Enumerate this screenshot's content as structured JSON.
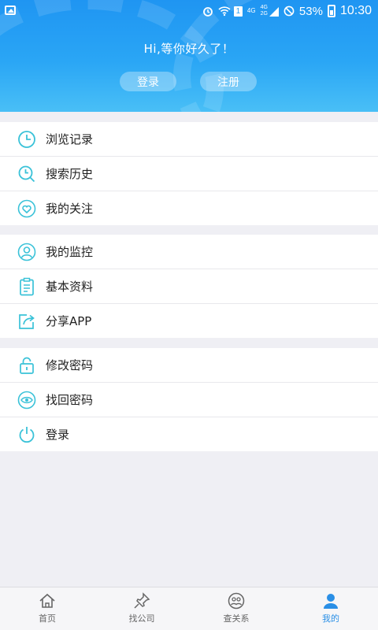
{
  "status_bar": {
    "network": "4G",
    "network2": "4G",
    "network3": "2G",
    "sim": "1",
    "battery_percent": "53%",
    "time": "10:30"
  },
  "header": {
    "greeting": "Hi,等你好久了！",
    "login_label": "登录",
    "register_label": "注册"
  },
  "menu": {
    "section1": [
      {
        "label": "浏览记录",
        "icon": "clock-icon"
      },
      {
        "label": "搜索历史",
        "icon": "search-history-icon"
      },
      {
        "label": "我的关注",
        "icon": "heart-icon"
      }
    ],
    "section2": [
      {
        "label": "我的监控",
        "icon": "user-icon"
      },
      {
        "label": "基本资料",
        "icon": "clipboard-icon"
      },
      {
        "label": "分享APP",
        "icon": "share-icon"
      }
    ],
    "section3": [
      {
        "label": "修改密码",
        "icon": "lock-icon"
      },
      {
        "label": "找回密码",
        "icon": "eye-icon"
      },
      {
        "label": "登录",
        "icon": "power-icon"
      }
    ]
  },
  "bottom_nav": [
    {
      "label": "首页",
      "icon": "home-icon",
      "active": false
    },
    {
      "label": "找公司",
      "icon": "pin-icon",
      "active": false
    },
    {
      "label": "查关系",
      "icon": "relations-icon",
      "active": false
    },
    {
      "label": "我的",
      "icon": "profile-icon",
      "active": true
    }
  ],
  "colors": {
    "accent": "#2a8fe6",
    "icon": "#3ac2d8",
    "header_top": "#1f95f2",
    "header_bottom": "#49bff6"
  }
}
